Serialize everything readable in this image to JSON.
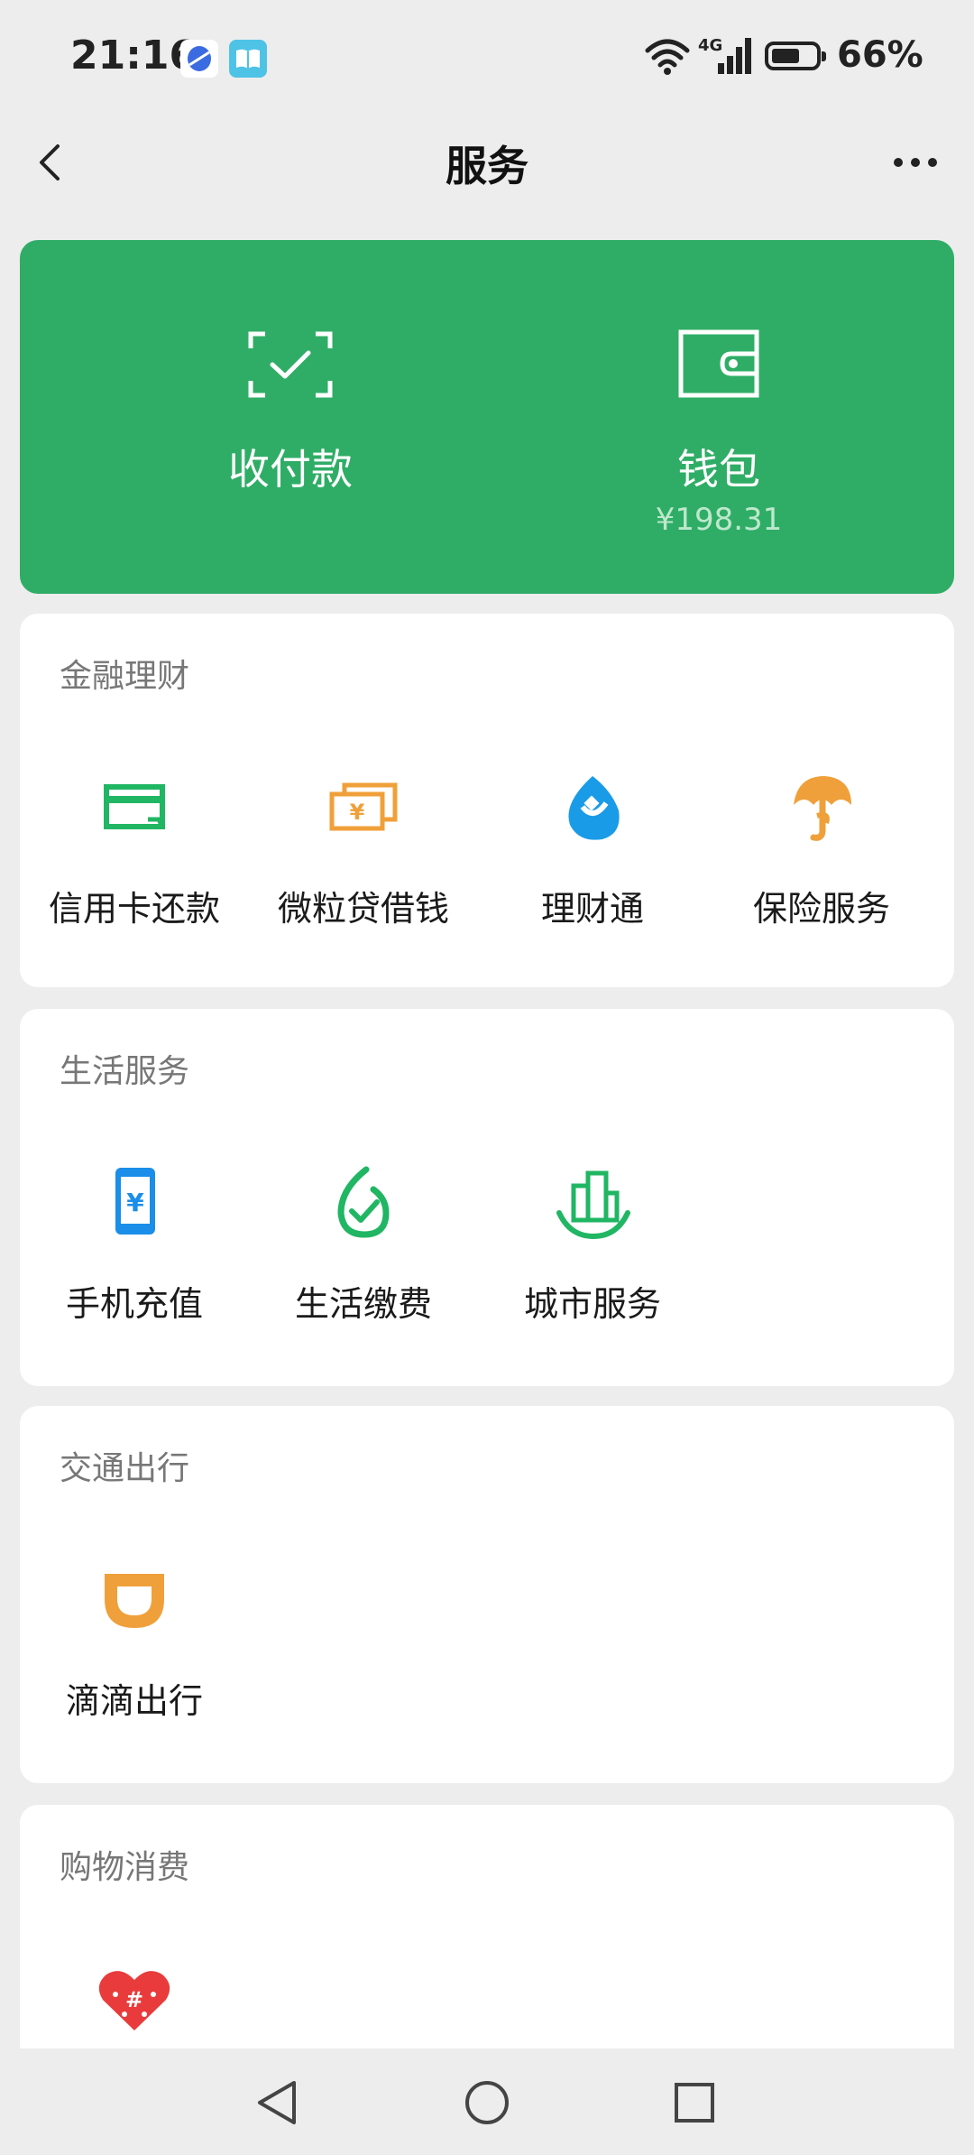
{
  "status_bar": {
    "time": "21:16",
    "battery_text": "66%",
    "battery_level": 0.66,
    "network": "4G"
  },
  "nav": {
    "title": "服务",
    "back_icon": "back-chevron-icon",
    "more_icon": "more-dots-icon"
  },
  "pay_card": {
    "color": "#2fad66",
    "pay": {
      "label": "收付款",
      "icon": "scan-check-icon"
    },
    "wallet": {
      "label": "钱包",
      "balance": "¥198.31",
      "icon": "wallet-icon"
    }
  },
  "sections": {
    "finance": {
      "title": "金融理财",
      "items": [
        {
          "label": "信用卡还款",
          "icon": "credit-card-icon"
        },
        {
          "label": "微粒贷借钱",
          "icon": "loan-bill-icon"
        },
        {
          "label": "理财通",
          "icon": "wealth-drop-icon"
        },
        {
          "label": "保险服务",
          "icon": "insurance-umbrella-icon"
        }
      ]
    },
    "life": {
      "title": "生活服务",
      "items": [
        {
          "label": "手机充值",
          "icon": "phone-topup-icon"
        },
        {
          "label": "生活缴费",
          "icon": "utility-payment-icon"
        },
        {
          "label": "城市服务",
          "icon": "city-services-icon"
        }
      ]
    },
    "transport": {
      "title": "交通出行",
      "items": [
        {
          "label": "滴滴出行",
          "icon": "didi-icon"
        }
      ]
    },
    "shopping": {
      "title": "购物消费",
      "items": [
        {
          "label": "",
          "icon": "pinduoduo-heart-icon"
        }
      ]
    }
  },
  "system_nav": {
    "back": "triangle-back-icon",
    "home": "circle-home-icon",
    "recents": "square-recents-icon"
  }
}
